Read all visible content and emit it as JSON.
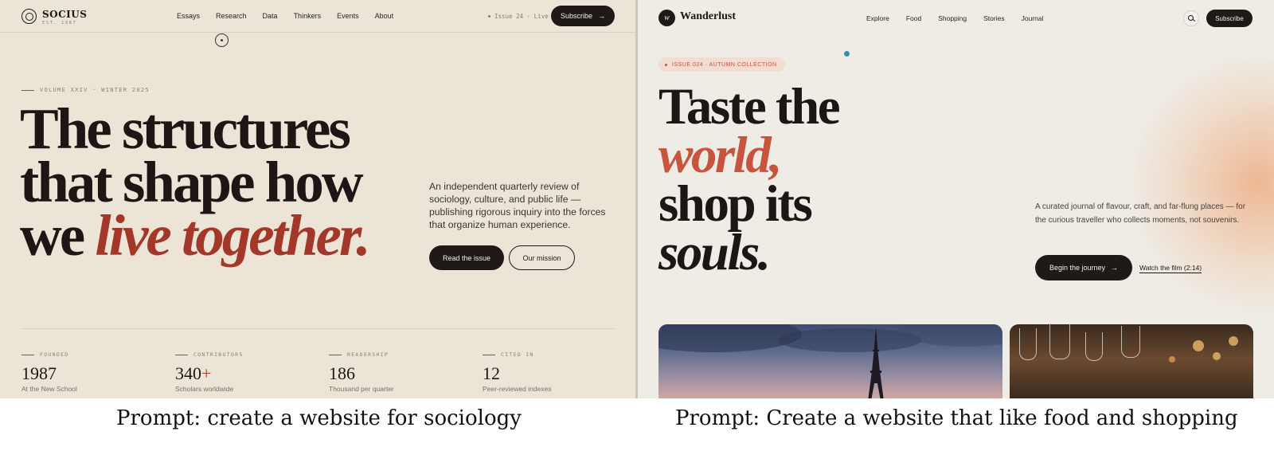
{
  "left_site": {
    "logo": {
      "name": "SOCIUS",
      "est": "EST. 1987"
    },
    "nav": [
      "Essays",
      "Research",
      "Data",
      "Thinkers",
      "Events",
      "About"
    ],
    "live_status": "Issue 24 · Live",
    "subscribe_label": "Subscribe",
    "volume_label": "VOLUME XXIV · WINTER 2025",
    "hero": {
      "line1": "The structures",
      "line2": "that shape how",
      "line3_plain": "we ",
      "line3_accent": "live together."
    },
    "description": "An independent quarterly review of sociology, culture, and public life — publishing rigorous inquiry into the forces that organize human experience.",
    "cta_primary": "Read the issue",
    "cta_secondary": "Our mission",
    "stats": [
      {
        "label": "FOUNDED",
        "value": "1987",
        "suffix": "",
        "sub": "At the New School"
      },
      {
        "label": "CONTRIBUTORS",
        "value": "340",
        "suffix": "+",
        "sub": "Scholars worldwide"
      },
      {
        "label": "READERSHIP",
        "value": "186",
        "suffix": "",
        "sub": "Thousand per quarter"
      },
      {
        "label": "CITED IN",
        "value": "12",
        "suffix": "",
        "sub": "Peer-reviewed indexes"
      }
    ],
    "colors": {
      "background": "#ede4d8",
      "accent": "#a3372a",
      "ink": "#1c1714"
    }
  },
  "right_site": {
    "logo": {
      "mark": "w",
      "name": "Wanderlust"
    },
    "nav": [
      "Explore",
      "Food",
      "Shopping",
      "Stories",
      "Journal"
    ],
    "subscribe_label": "Subscribe",
    "badge": "ISSUE 024 · AUTUMN COLLECTION",
    "hero": {
      "line1": "Taste the",
      "line2_accent": "world,",
      "line3": "shop its",
      "line4_italic": "souls."
    },
    "description": "A curated journal of flavour, craft, and far-flung places — for the curious traveller who collects moments, not souvenirs.",
    "cta_primary": "Begin the journey",
    "cta_secondary": "Watch the film (2:14)",
    "colors": {
      "background": "#efebe5",
      "accent": "#c7553e",
      "glow": "#eea678"
    }
  },
  "captions": {
    "left": "Prompt: create a website for sociology",
    "right": "Prompt: Create a website that like food and shopping"
  }
}
